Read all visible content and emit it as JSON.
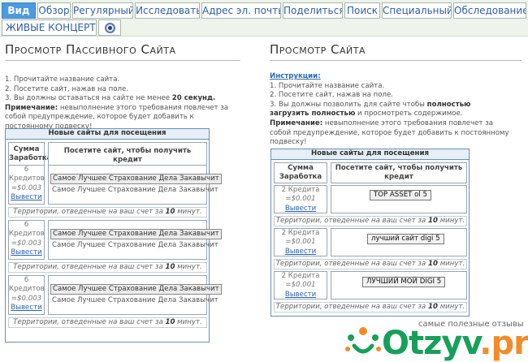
{
  "tabs": [
    {
      "label": "Вид",
      "active": true
    },
    {
      "label": "Обзор",
      "active": false
    },
    {
      "label": "Регулярный",
      "active": false
    },
    {
      "label": "Исследовать",
      "active": false
    },
    {
      "label": "Адрес эл. почты",
      "active": false
    },
    {
      "label": "Поделиться",
      "active": false
    },
    {
      "label": "Поиск",
      "active": false
    },
    {
      "label": "Специальный",
      "active": false
    },
    {
      "label": "Обследование",
      "active": false
    }
  ],
  "tabs_row2": [
    {
      "label": "ЖИВЫЕ КОНЦЕРТЫ"
    }
  ],
  "left": {
    "title": "Просмотр Пассивного Сайта",
    "steps": [
      "1. Прочитайте название сайта.",
      "2. Посетите сайт, нажав на поле."
    ],
    "step3_pre": "3. Вы должны оставаться на сайте не менее ",
    "step3_bold": "20 секунд.",
    "note_label": "Примечание:",
    "note_text": " невыполнение этого требования повлечет за собой предупреждение, которое будет добавить к постоянному подвеску!",
    "table": {
      "header": "Новые сайты для посещения",
      "col1": "Сумма Заработка",
      "col2": "Посетите сайт, чтобы получить кредит",
      "rows": [
        {
          "credits": "6",
          "credits_label": "Кредитов",
          "amount": "=$0.003",
          "withdraw": "Вывести",
          "button": "Самое Лучшее Страхование Дела Закавычит",
          "title": "Самое Лучшее Страхование Дела Закавычит"
        },
        {
          "credits": "6",
          "credits_label": "Кредитов",
          "amount": "=$0.003",
          "withdraw": "Вывести",
          "button": "Самое Лучшее Страхование Дела Закавычит",
          "title": "Самое Лучшее Страхование Дела Закавычит"
        },
        {
          "credits": "6",
          "credits_label": "Кредитов",
          "amount": "=$0.003",
          "withdraw": "Вывести",
          "button": "Самое Лучшее Страхование Дела Закавычит",
          "title": "Самое Лучшее Страхование Дела Закавычит"
        }
      ],
      "note_pre": "Территории, отведенные на ваш счет за ",
      "note_bold": "10",
      "note_post": " минут."
    }
  },
  "right": {
    "title": "Просмотр Сайта",
    "instructions_label": "Инструкции:",
    "steps": [
      "1. Прочитайте название сайта.",
      "2. Посетите сайт, нажав на поле."
    ],
    "step3_pre": "3. Вы должны позволить для сайте чтобы ",
    "step3_bold": "полностью загрузить полностью",
    "step3_post": "   и просмотреть содержимое.",
    "note_label": "Примечание:",
    "note_text": " невыполнение этого требования повлечет за собой предупреждение, которое будет добавить к постоянному подвеску!",
    "table": {
      "header": "Новые сайты для посещения",
      "col1": "Сумма Заработка",
      "col2": "Посетите сайт, чтобы получить кредит",
      "rows": [
        {
          "credits": "2 Кредита",
          "amount": "=$0.001",
          "withdraw": "Вывести",
          "button": "TOP ASSET ol 5"
        },
        {
          "credits": "2 Кредита",
          "amount": "=$0.001",
          "withdraw": "Вывести",
          "button": "лучший сайт digi 5"
        },
        {
          "credits": "2 Кредита",
          "amount": "=$0.001",
          "withdraw": "Вывести",
          "button": "ЛУЧШИЙ МОЙ DIGI 5"
        }
      ],
      "note_pre": "Территории, отведенные на ваш счет за ",
      "note_bold": "10",
      "note_post": " минут."
    }
  },
  "watermark": {
    "tagline": "самые полезные отзывы",
    "brand_main": "Otzyv",
    "brand_suffix": ".pro",
    "colors": {
      "green": "#16a05a",
      "orange": "#f28c28"
    }
  },
  "colors": {
    "tab_active": "#4c9be0",
    "link": "#2a62b0",
    "table_border": "#6c8fb0"
  }
}
